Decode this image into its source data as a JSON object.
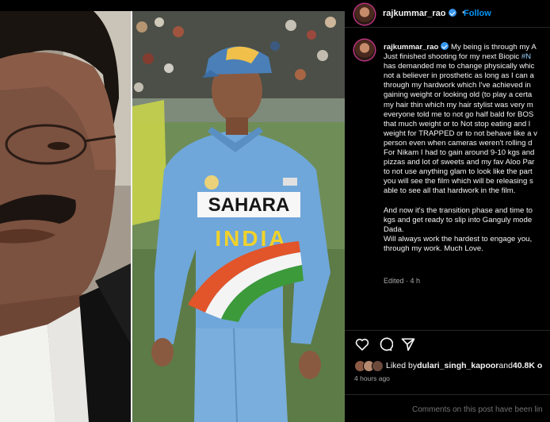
{
  "post": {
    "username": "rajkummar_rao",
    "follow_label": "Follow",
    "header_separator": "•",
    "caption_lines": [
      {
        "text": "My being is through my A",
        "has_user": true
      },
      {
        "text": "Just finished shooting for my next Biopic #N"
      },
      {
        "text": "has demanded me to change physically whic"
      },
      {
        "text": "not a believer in prosthetic as long as I can a"
      },
      {
        "text": "through my hardwork which I've achieved in"
      },
      {
        "text": "gaining weight or looking old (to play a certa"
      },
      {
        "text": "my hair thin which my hair stylist was very m"
      },
      {
        "text": "everyone told me to not go half bald for BOS"
      },
      {
        "text": "that much weight or to Not stop eating and l"
      },
      {
        "text": "weight for TRAPPED or to not behave like a v"
      },
      {
        "text": "person even when cameras weren't rolling d"
      },
      {
        "text": "For Nikam I had to gain around 9-10 kgs and"
      },
      {
        "text": "pizzas and lot of sweets and my fav Aloo Par"
      },
      {
        "text": "to not use anything glam to look like the part"
      },
      {
        "text": "you will see the film which will be releasing s"
      },
      {
        "text": "able to see all that hardwork in the film."
      },
      {
        "text": ""
      },
      {
        "text": "And now it's the transition phase and time to"
      },
      {
        "text": "kgs and get ready to slip into Ganguly mode"
      },
      {
        "text": "Dada."
      },
      {
        "text": "Will always work the hardest to engage you,"
      },
      {
        "text": "through my work. Much Love."
      }
    ],
    "hashtag_fragment": "#N",
    "edited_label": "Edited · 4 h",
    "likes": {
      "prefix": "Liked by ",
      "liker": "dulari_singh_kapoor",
      "and": " and ",
      "others": "40.8K o"
    },
    "time_ago": "4 hours ago",
    "comments_status": "Comments on this post have been lin"
  },
  "icons": {
    "like": "heart-icon",
    "comment": "comment-icon",
    "share": "share-icon",
    "verified": "verified-badge-icon"
  },
  "colors": {
    "accent_link": "#0095f6",
    "verified": "#3897f0",
    "muted_text": "#a8a8a8",
    "background": "#000000"
  },
  "photo": {
    "jersey_text_line1": "SAHARA",
    "jersey_text_line2": "INDIA"
  }
}
